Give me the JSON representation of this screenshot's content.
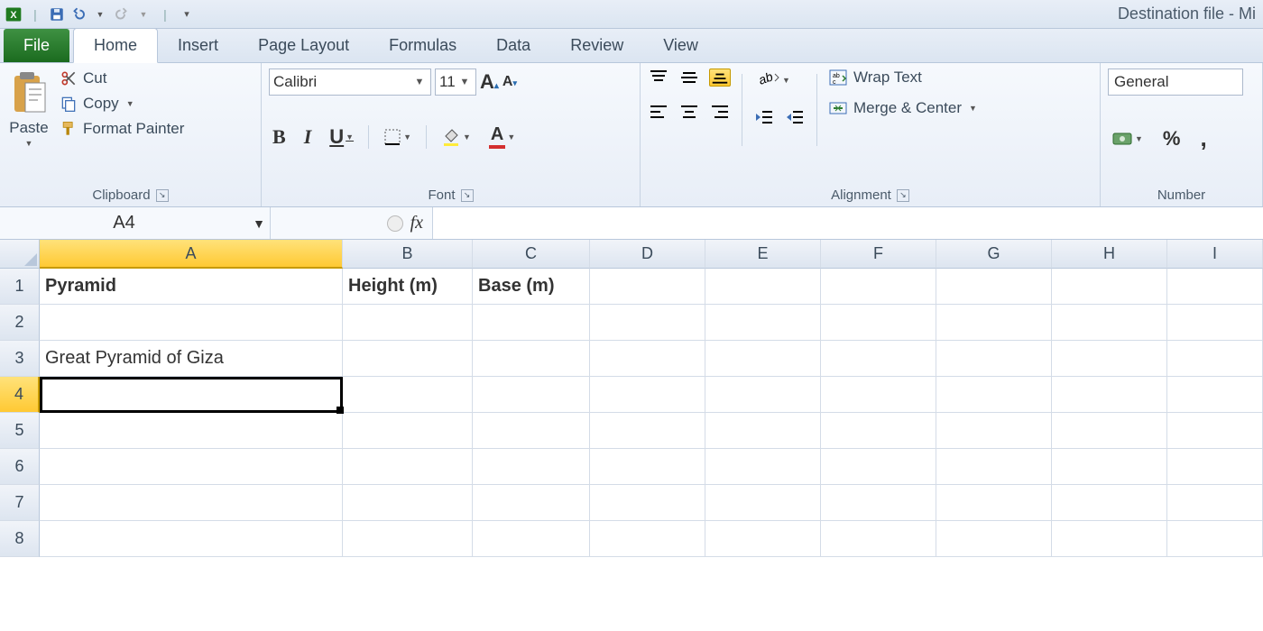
{
  "window": {
    "title": "Destination file  -  Mi"
  },
  "qat": {
    "save_tip": "Save",
    "undo_tip": "Undo",
    "redo_tip": "Redo"
  },
  "tabs": {
    "file": "File",
    "list": [
      "Home",
      "Insert",
      "Page Layout",
      "Formulas",
      "Data",
      "Review",
      "View"
    ],
    "active": "Home"
  },
  "ribbon": {
    "clipboard": {
      "label": "Clipboard",
      "paste": "Paste",
      "cut": "Cut",
      "copy": "Copy",
      "format_painter": "Format Painter"
    },
    "font": {
      "label": "Font",
      "name": "Calibri",
      "size": "11",
      "big_a": "A",
      "small_a": "A",
      "bold": "B",
      "italic": "I",
      "underline": "U",
      "fill_tip": "Fill Color",
      "font_color": "A",
      "border_tip": "Borders"
    },
    "alignment": {
      "label": "Alignment",
      "wrap": "Wrap Text",
      "merge": "Merge & Center"
    },
    "number": {
      "label": "Number",
      "format": "General",
      "percent": "%",
      "comma": ","
    }
  },
  "fx": {
    "namebox": "A4",
    "fx_label": "fx",
    "formula": ""
  },
  "grid": {
    "columns": [
      "A",
      "B",
      "C",
      "D",
      "E",
      "F",
      "G",
      "H",
      "I"
    ],
    "rows": [
      "1",
      "2",
      "3",
      "4",
      "5",
      "6",
      "7",
      "8"
    ],
    "selected_col": "A",
    "selected_row": "4",
    "cells": {
      "A1": "Pyramid",
      "B1": "Height (m)",
      "C1": "Base (m)",
      "A3": "Great Pyramid of Giza"
    }
  }
}
